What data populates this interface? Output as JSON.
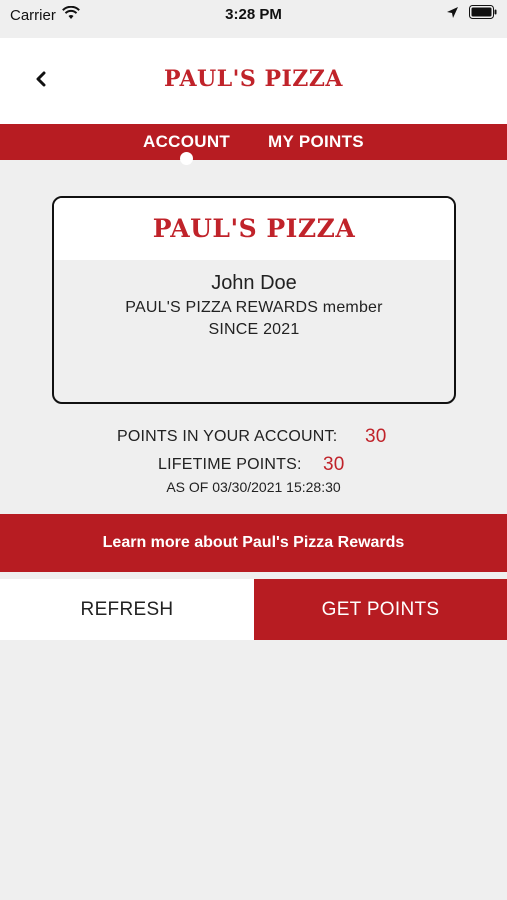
{
  "status_bar": {
    "carrier": "Carrier",
    "time": "3:28 PM",
    "icons": [
      "wifi-icon",
      "location-arrow-icon",
      "battery-icon"
    ]
  },
  "nav": {
    "logo": "PAUL'S PIZZA",
    "back_icon": "chevron-left-icon"
  },
  "tabs": [
    {
      "label": "ACCOUNT",
      "active": true
    },
    {
      "label": "MY POINTS",
      "active": false
    }
  ],
  "card": {
    "logo": "PAUL'S PIZZA",
    "name": "John Doe",
    "membership": "PAUL'S PIZZA REWARDS member",
    "since": "SINCE 2021"
  },
  "points": {
    "account_label": "POINTS IN YOUR ACCOUNT:",
    "account_value": "30",
    "lifetime_label": "LIFETIME POINTS:",
    "lifetime_value": "30",
    "as_of": "AS OF 03/30/2021 15:28:30"
  },
  "learn_more": "Learn more about Paul's Pizza Rewards",
  "buttons": {
    "refresh": "REFRESH",
    "get_points": "GET POINTS"
  },
  "colors": {
    "brand_red": "#b71c22",
    "value_red": "#c0232a",
    "background": "#efefef"
  }
}
